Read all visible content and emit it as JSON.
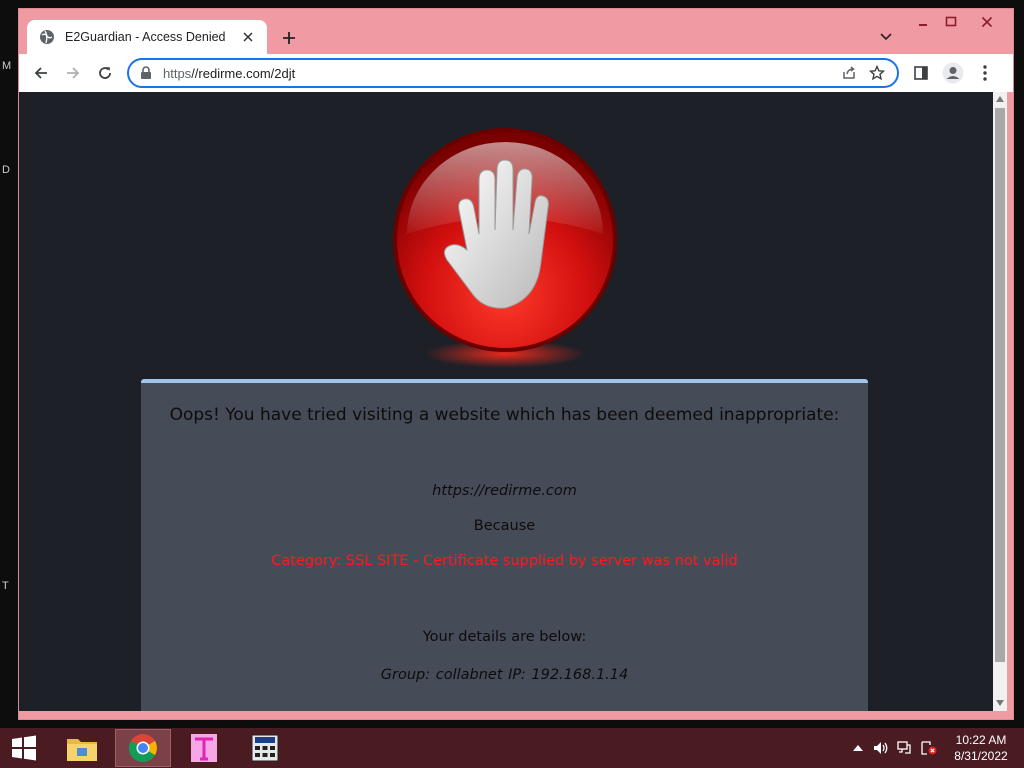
{
  "desktop": {
    "edge_letters": [
      "M",
      "D",
      "T"
    ]
  },
  "browser": {
    "tab_title": "E2Guardian - Access Denied",
    "url_scheme": "https",
    "url_rest": "//redirme.com/2djt",
    "frame_color": "#f09aa3",
    "omnibox_focus_color": "#1a73e8"
  },
  "page": {
    "heading": "Oops! You have tried visiting a website which has been deemed inappropriate:",
    "blocked_url": "https://redirme.com",
    "because": "Because",
    "reason": "Category: SSL SITE - Certificate supplied by server was not valid",
    "details_heading": "Your details are below:",
    "details": "Group: collabnet   IP: 192.168.1.14",
    "background_color": "#1e2027",
    "panel_color": "#464b58",
    "reason_color": "#ff1a1a"
  },
  "taskbar": {
    "apps": [
      "file-explorer-icon",
      "chrome-icon",
      "typora-icon",
      "calculator-icon"
    ],
    "time": "10:22 AM",
    "date": "8/31/2022",
    "color": "#4b1b22"
  }
}
